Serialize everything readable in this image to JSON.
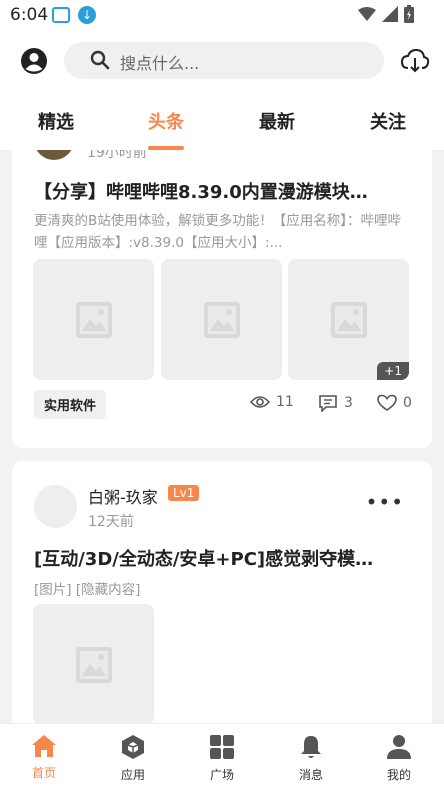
{
  "status_bar": {
    "time": "6:04"
  },
  "header": {
    "search_placeholder": "搜点什么..."
  },
  "tabs": [
    {
      "label": "精选"
    },
    {
      "label": "头条"
    },
    {
      "label": "最新"
    },
    {
      "label": "关注"
    }
  ],
  "posts": [
    {
      "time": "19小时前",
      "title": "【分享】哔哩哔哩8.39.0内置漫游模块…",
      "desc": "更清爽的B站使用体验，解锁更多功能！【应用名称】：哔哩哔哩【应用版本】:v8.39.0【应用大小】:...",
      "extra_images": "+1",
      "tag": "实用软件",
      "views": "11",
      "comments": "3",
      "likes": "0"
    },
    {
      "author": "白粥-玖家",
      "level": "Lv1",
      "time": "12天前",
      "title": "[互动/3D/全动态/安卓+PC]感觉剥夺模…",
      "desc": "[图片] [隐藏内容]"
    }
  ],
  "bottom_nav": [
    {
      "label": "首页"
    },
    {
      "label": "应用"
    },
    {
      "label": "广场"
    },
    {
      "label": "消息"
    },
    {
      "label": "我的"
    }
  ],
  "colors": {
    "accent": "#f5884a",
    "background": "#f2f2f2"
  }
}
